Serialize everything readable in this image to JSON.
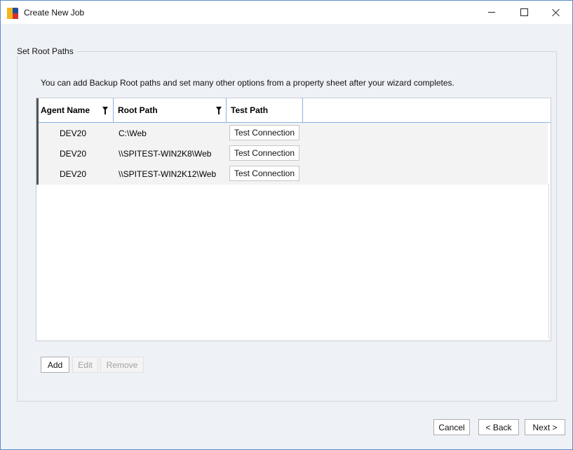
{
  "window": {
    "title": "Create New Job",
    "app_icon_text": "SE"
  },
  "group": {
    "title": "Set Root Paths"
  },
  "info_text": "You can add Backup Root paths and set many other options from a property sheet after your wizard completes.",
  "grid": {
    "columns": [
      "Agent Name",
      "Root Path",
      "Test Path"
    ],
    "rows": [
      {
        "agent": "DEV20",
        "root_path": "C:\\Web",
        "test_label": "Test Connection"
      },
      {
        "agent": "DEV20",
        "root_path": "\\\\SPITEST-WIN2K8\\Web",
        "test_label": "Test Connection"
      },
      {
        "agent": "DEV20",
        "root_path": "\\\\SPITEST-WIN2K12\\Web",
        "test_label": "Test Connection"
      }
    ]
  },
  "actions": {
    "add": "Add",
    "edit": "Edit",
    "remove": "Remove"
  },
  "footer": {
    "cancel": "Cancel",
    "back": "< Back",
    "next": "Next >"
  },
  "colors": {
    "accent_border": "#5b8ec9",
    "header_divider": "#8cb3e0",
    "dialog_bg": "#eef1f6"
  }
}
